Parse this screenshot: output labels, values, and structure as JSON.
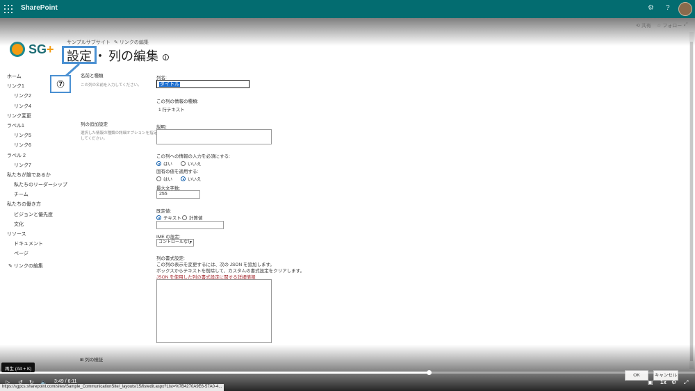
{
  "suite": {
    "brand": "SharePoint"
  },
  "commands": {
    "share": "共有",
    "follow": "フォロー"
  },
  "site": {
    "name_part1": "SG",
    "name_part2": "+"
  },
  "breadcrumb": "サンプルサブサイト",
  "edit_link": "リンクの編集",
  "title": {
    "main": "設定",
    "sep": "・",
    "sub": "列の編集",
    "info": "i"
  },
  "annotation": {
    "callout": "⑦"
  },
  "nav": [
    {
      "label": "ホーム",
      "level": 0
    },
    {
      "label": "リンク1",
      "level": 0
    },
    {
      "label": "リンク2",
      "level": 1
    },
    {
      "label": "リンク4",
      "level": 1
    },
    {
      "label": "リンク変更",
      "level": 0
    },
    {
      "label": "ラベル1",
      "level": 0
    },
    {
      "label": "リンク5",
      "level": 1
    },
    {
      "label": "リンク6",
      "level": 1
    },
    {
      "label": "ラベル 2",
      "level": 0
    },
    {
      "label": "リンク7",
      "level": 1
    },
    {
      "label": "私たちが誰であるか",
      "level": 0
    },
    {
      "label": "私たちのリーダーシップ",
      "level": 1
    },
    {
      "label": "チーム",
      "level": 1
    },
    {
      "label": "私たちの働き方",
      "level": 0
    },
    {
      "label": "ビジョンと優先度",
      "level": 1
    },
    {
      "label": "文化",
      "level": 1
    },
    {
      "label": "リソース",
      "level": 0
    },
    {
      "label": "ドキュメント",
      "level": 1
    },
    {
      "label": "ページ",
      "level": 1
    }
  ],
  "nav_edit": "リンクの編集",
  "sections": {
    "name_type": {
      "heading": "名前と種類",
      "desc": "この列の名前を入力してください。"
    },
    "additional": {
      "heading": "列の追加設定",
      "desc": "選択した情報の種類の詳細オプションを指定してください。"
    }
  },
  "form": {
    "column_name_label": "列名:",
    "column_name_value": "タイトル",
    "info_type_label": "この列の情報の種類:",
    "info_type_value": "1 行テキスト",
    "description_label": "説明:",
    "required_label": "この列への情報の入力を必須にする:",
    "required_yes": "はい",
    "required_no": "いいえ",
    "unique_label": "固有の値を適用する:",
    "unique_yes": "はい",
    "unique_no": "いいえ",
    "maxlen_label": "最大文字数:",
    "maxlen_value": "255",
    "default_label": "既定値:",
    "default_text": "テキスト",
    "default_calc": "計算値",
    "ime_label": "IME の設定:",
    "ime_value": "コントロールなし",
    "format_label": "列の書式設定:",
    "format_desc1": "この列の表示を変更するには、次の JSON を追加します。",
    "format_desc2": "ボックスからテキストを削除して、カスタムの書式設定をクリアします。",
    "format_link": "JSON を使用した列の書式設定に関する詳細情報",
    "validation": "列の検証"
  },
  "buttons": {
    "ok": "OK",
    "cancel": "キャンセル"
  },
  "player": {
    "tooltip": "再生 (Alt + K)",
    "time": "3:49 / 6:11",
    "speed": "1x",
    "progress": 0.617,
    "url": "https://sgpcs.sharepoint.com/sites/Sample_CommunicationSite/_layouts/15/listedit.aspx?List=%7B4270A9E6-57A0-4..."
  }
}
